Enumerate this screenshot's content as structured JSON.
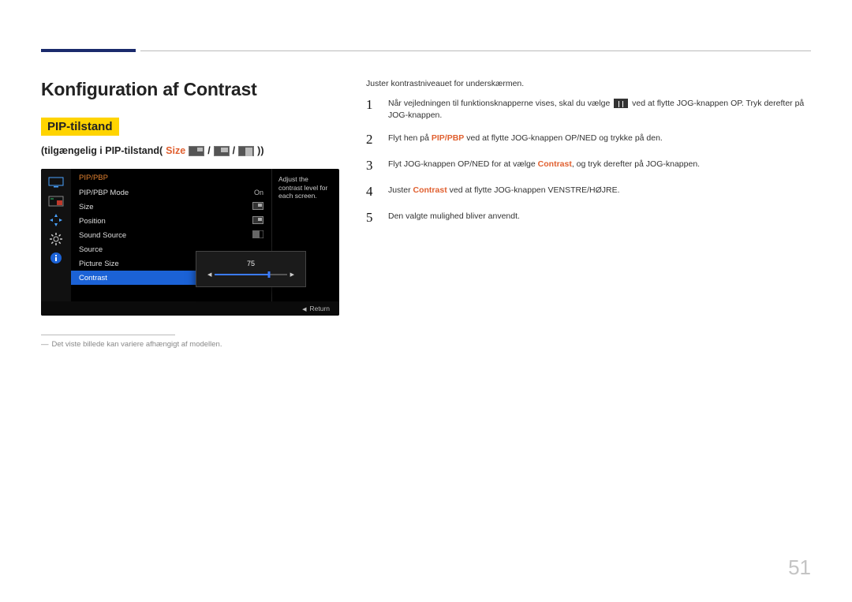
{
  "page_number": "51",
  "top": {
    "accent": "navy-bar"
  },
  "left": {
    "title": "Konfiguration af Contrast",
    "pip_badge": "PIP-tilstand",
    "availability_prefix": "(tilgængelig i PIP-tilstand(",
    "availability_size_word": "Size",
    "availability_sep": " / ",
    "availability_suffix": "))",
    "osm": {
      "title": "PIP/PBP",
      "rows": [
        {
          "label": "PIP/PBP Mode",
          "value": "On"
        },
        {
          "label": "Size",
          "value": ""
        },
        {
          "label": "Position",
          "value": ""
        },
        {
          "label": "Sound Source",
          "value": ""
        },
        {
          "label": "Source",
          "value": ""
        },
        {
          "label": "Picture Size",
          "value": ""
        },
        {
          "label": "Contrast",
          "value": ""
        }
      ],
      "desc": "Adjust the contrast level for each screen.",
      "slider_value": "75",
      "return_label": "Return"
    },
    "footnote": "Det viste billede kan variere afhængigt af modellen."
  },
  "right": {
    "intro": "Juster kontrastniveauet for underskærmen.",
    "steps": [
      {
        "n": "1",
        "pre": "Når vejledningen til funktionsknapperne vises, skal du vælge ",
        "post": " ved at flytte JOG-knappen OP. Tryk derefter på JOG-knappen."
      },
      {
        "n": "2",
        "pre": "Flyt hen på ",
        "hl": "PIP/PBP",
        "post": " ved at flytte JOG-knappen OP/NED og trykke på den."
      },
      {
        "n": "3",
        "pre": "Flyt JOG-knappen OP/NED for at vælge ",
        "hl": "Contrast",
        "post": ", og tryk derefter på JOG-knappen."
      },
      {
        "n": "4",
        "pre": "Juster ",
        "hl": "Contrast",
        "post": " ved at flytte JOG-knappen VENSTRE/HØJRE."
      },
      {
        "n": "5",
        "pre": "",
        "hl": "",
        "post": "Den valgte mulighed bliver anvendt."
      }
    ]
  }
}
